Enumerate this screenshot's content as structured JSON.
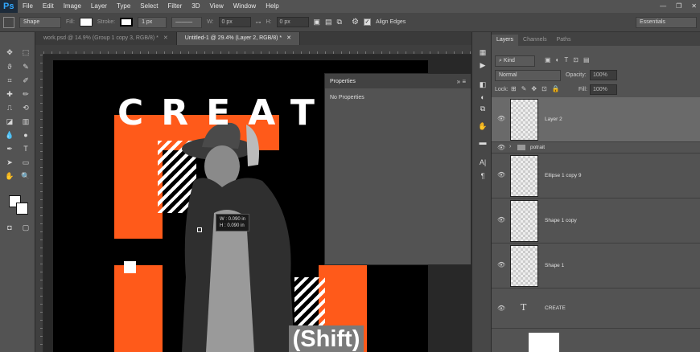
{
  "app": {
    "logo": "Ps"
  },
  "menu": [
    "File",
    "Edit",
    "Image",
    "Layer",
    "Type",
    "Select",
    "Filter",
    "3D",
    "View",
    "Window",
    "Help"
  ],
  "window_controls": [
    "—",
    "❐",
    "✕"
  ],
  "options": {
    "mode": "Shape",
    "fill_label": "Fill:",
    "stroke_label": "Stroke:",
    "stroke_width": "1 px",
    "w_label": "W:",
    "w_value": "0 px",
    "h_label": "H:",
    "h_value": "0 px",
    "align_edges": "Align Edges",
    "workspace": "Essentials"
  },
  "tabs": [
    {
      "label": "work.psd @ 14.9% (Group 1 copy 3, RGB/8) *",
      "active": false
    },
    {
      "label": "Untitled-1 @ 29.4% (Layer 2, RGB/8) *",
      "active": true
    }
  ],
  "canvas": {
    "headline": "CREAT",
    "shortcut_label": "(Shift)",
    "readout_w": "W :  0.090 in",
    "readout_h": "H :  0.090 in"
  },
  "properties": {
    "title": "Properties",
    "body": "No Properties"
  },
  "layers_panel": {
    "tabs": [
      "Layers",
      "Channels",
      "Paths"
    ],
    "filter": "Kind",
    "blend_mode": "Normal",
    "opacity_label": "Opacity:",
    "opacity_value": "100%",
    "lock_label": "Lock:",
    "fill_label": "Fill:",
    "fill_value": "100%",
    "layers": [
      {
        "name": "Layer 2",
        "kind": "pixel",
        "selected": true
      },
      {
        "name": "potrait",
        "kind": "group",
        "selected": false
      },
      {
        "name": "Ellipse 1 copy 9",
        "kind": "shape",
        "selected": false
      },
      {
        "name": "Shape 1 copy",
        "kind": "shape",
        "selected": false
      },
      {
        "name": "Shape 1",
        "kind": "shape",
        "selected": false
      },
      {
        "name": "CREATE",
        "kind": "text",
        "selected": false
      }
    ]
  },
  "colors": {
    "accent_orange": "#ff5a1a",
    "ui_dark": "#282828",
    "ui_panel": "#535353"
  }
}
